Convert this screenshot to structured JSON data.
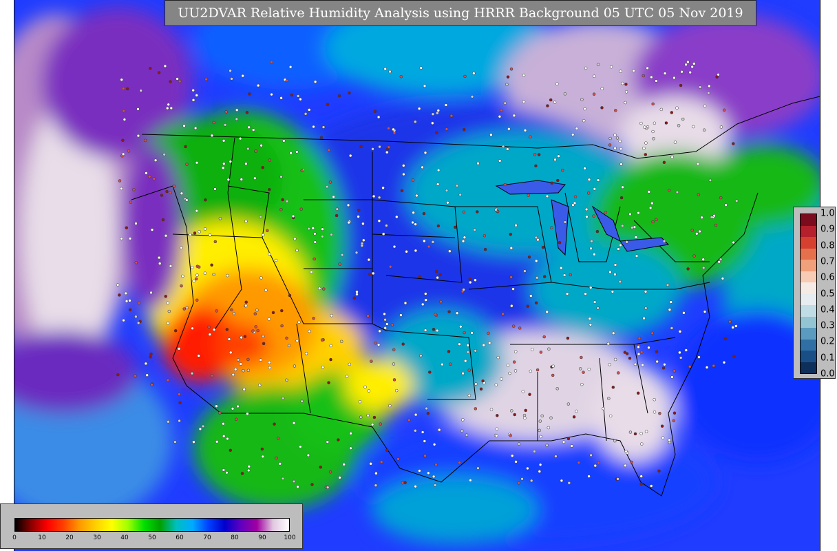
{
  "title": "UU2DVAR Relative Humidity Analysis using HRRR Background 05 UTC 05 Nov 2019",
  "rh_colorbar": {
    "labels": [
      "0",
      "10",
      "20",
      "30",
      "40",
      "50",
      "60",
      "70",
      "80",
      "90",
      "100"
    ],
    "colors": [
      "#000000",
      "#8b0000",
      "#ff0000",
      "#ff4000",
      "#ff9900",
      "#ffd000",
      "#ffff00",
      "#a0ff00",
      "#00e000",
      "#00a000",
      "#00bfbf",
      "#00aaff",
      "#0040ff",
      "#0000cc",
      "#6000c0",
      "#a000a0",
      "#e0c8e0",
      "#ffffff"
    ]
  },
  "increment_colorbar": {
    "labels": [
      "1.0",
      "0.9",
      "0.8",
      "0.7",
      "0.6",
      "0.5",
      "0.4",
      "0.3",
      "0.2",
      "0.1",
      "0.0"
    ],
    "colors": [
      "#7a0c1e",
      "#b5202c",
      "#d6412f",
      "#e4714c",
      "#f0a07a",
      "#f7cbb4",
      "#f5ebe4",
      "#e6ecef",
      "#c0dce5",
      "#93c4d2",
      "#5a9bbf",
      "#2f6fa4",
      "#1a4f86",
      "#0d2f5a"
    ]
  },
  "map_colors": {
    "ocean": "#1f3cff",
    "ocean_light": "#3a8ce6",
    "very_humid": "#e0d4e4",
    "humid_purple": "#7a2dbf",
    "blue": "#1030e0",
    "cyan": "#00a8c8",
    "green": "#14c014",
    "yellow": "#ffee00",
    "orange": "#ff9900",
    "red": "#ff1a00",
    "borders": "#000000"
  }
}
